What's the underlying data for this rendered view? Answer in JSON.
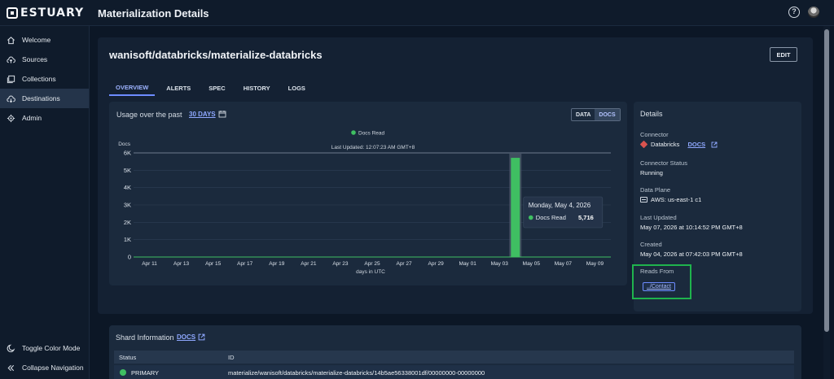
{
  "app": {
    "logo_text": "ESTUARY",
    "page_title": "Materialization Details"
  },
  "topbar": {
    "help_icon": "help-circle-icon",
    "avatar_icon": "user-avatar-icon"
  },
  "sidebar": {
    "items": [
      {
        "label": "Welcome",
        "icon": "home-icon",
        "active": false
      },
      {
        "label": "Sources",
        "icon": "cloud-upload-icon",
        "active": false
      },
      {
        "label": "Collections",
        "icon": "collections-icon",
        "active": false
      },
      {
        "label": "Destinations",
        "icon": "cloud-download-icon",
        "active": true
      },
      {
        "label": "Admin",
        "icon": "gear-icon",
        "active": false
      }
    ],
    "bottom": [
      {
        "label": "Toggle Color Mode",
        "icon": "moon-icon"
      },
      {
        "label": "Collapse Navigation",
        "icon": "double-chevron-left-icon"
      }
    ]
  },
  "entity": {
    "name": "wanisoft/databricks/materialize-databricks",
    "edit_label": "EDIT"
  },
  "tabs": [
    {
      "label": "OVERVIEW",
      "active": true
    },
    {
      "label": "ALERTS",
      "active": false
    },
    {
      "label": "SPEC",
      "active": false
    },
    {
      "label": "HISTORY",
      "active": false
    },
    {
      "label": "LOGS",
      "active": false
    }
  ],
  "usage": {
    "label": "Usage over the past",
    "range_link": "30 DAYS",
    "toggle": [
      {
        "label": "DATA",
        "selected": false
      },
      {
        "label": "DOCS",
        "selected": true
      }
    ]
  },
  "chart_data": {
    "type": "bar",
    "title": "",
    "legend": [
      "Docs Read"
    ],
    "legend_position": "top-center",
    "last_updated": "Last Updated: 12:07:23 AM GMT+8",
    "ylabel": "Docs",
    "xlabel": "days in UTC",
    "ylim": [
      0,
      6000
    ],
    "yticks": [
      "0",
      "1K",
      "2K",
      "3K",
      "4K",
      "5K",
      "6K"
    ],
    "xlim": [
      "2026-04-10",
      "2026-05-10"
    ],
    "xticks": [
      {
        "date": "2026-04-11",
        "label": "Apr 11"
      },
      {
        "date": "2026-04-13",
        "label": "Apr 13"
      },
      {
        "date": "2026-04-15",
        "label": "Apr 15"
      },
      {
        "date": "2026-04-17",
        "label": "Apr 17"
      },
      {
        "date": "2026-04-19",
        "label": "Apr 19"
      },
      {
        "date": "2026-04-21",
        "label": "Apr 21"
      },
      {
        "date": "2026-04-23",
        "label": "Apr 23"
      },
      {
        "date": "2026-04-25",
        "label": "Apr 25"
      },
      {
        "date": "2026-04-27",
        "label": "Apr 27"
      },
      {
        "date": "2026-04-29",
        "label": "Apr 29"
      },
      {
        "date": "2026-05-01",
        "label": "May 01"
      },
      {
        "date": "2026-05-03",
        "label": "May 03"
      },
      {
        "date": "2026-05-05",
        "label": "May 05"
      },
      {
        "date": "2026-05-07",
        "label": "May 07"
      },
      {
        "date": "2026-05-09",
        "label": "May 09"
      }
    ],
    "series": [
      {
        "name": "Docs Read",
        "color": "#3fbf62",
        "points": [
          {
            "date": "2026-05-04",
            "value": 5716
          }
        ]
      }
    ],
    "tooltip": {
      "date": "Monday, May 4, 2026",
      "series": "Docs Read",
      "value": "5,716"
    },
    "grid": true
  },
  "details": {
    "heading": "Details",
    "connector_label": "Connector",
    "connector_value": "Databricks",
    "connector_docs": "DOCS",
    "connector_status_label": "Connector Status",
    "connector_status_value": "Running",
    "data_plane_label": "Data Plane",
    "data_plane_value": "AWS: us-east-1 c1",
    "last_updated_label": "Last Updated",
    "last_updated_value": "May 07, 2026 at 10:14:52 PM GMT+8",
    "created_label": "Created",
    "created_value": "May 04, 2026 at 07:42:03 PM GMT+8",
    "reads_from_label": "Reads From",
    "reads_from_value": "../Contact",
    "highlight_color": "#1fb34d"
  },
  "shards": {
    "title": "Shard Information",
    "docs": "DOCS",
    "columns": [
      "Status",
      "ID"
    ],
    "rows": [
      {
        "status": "PRIMARY",
        "id": "materialize/wanisoft/databricks/materialize-databricks/14b5ae56338001df/00000000-00000000"
      }
    ]
  }
}
